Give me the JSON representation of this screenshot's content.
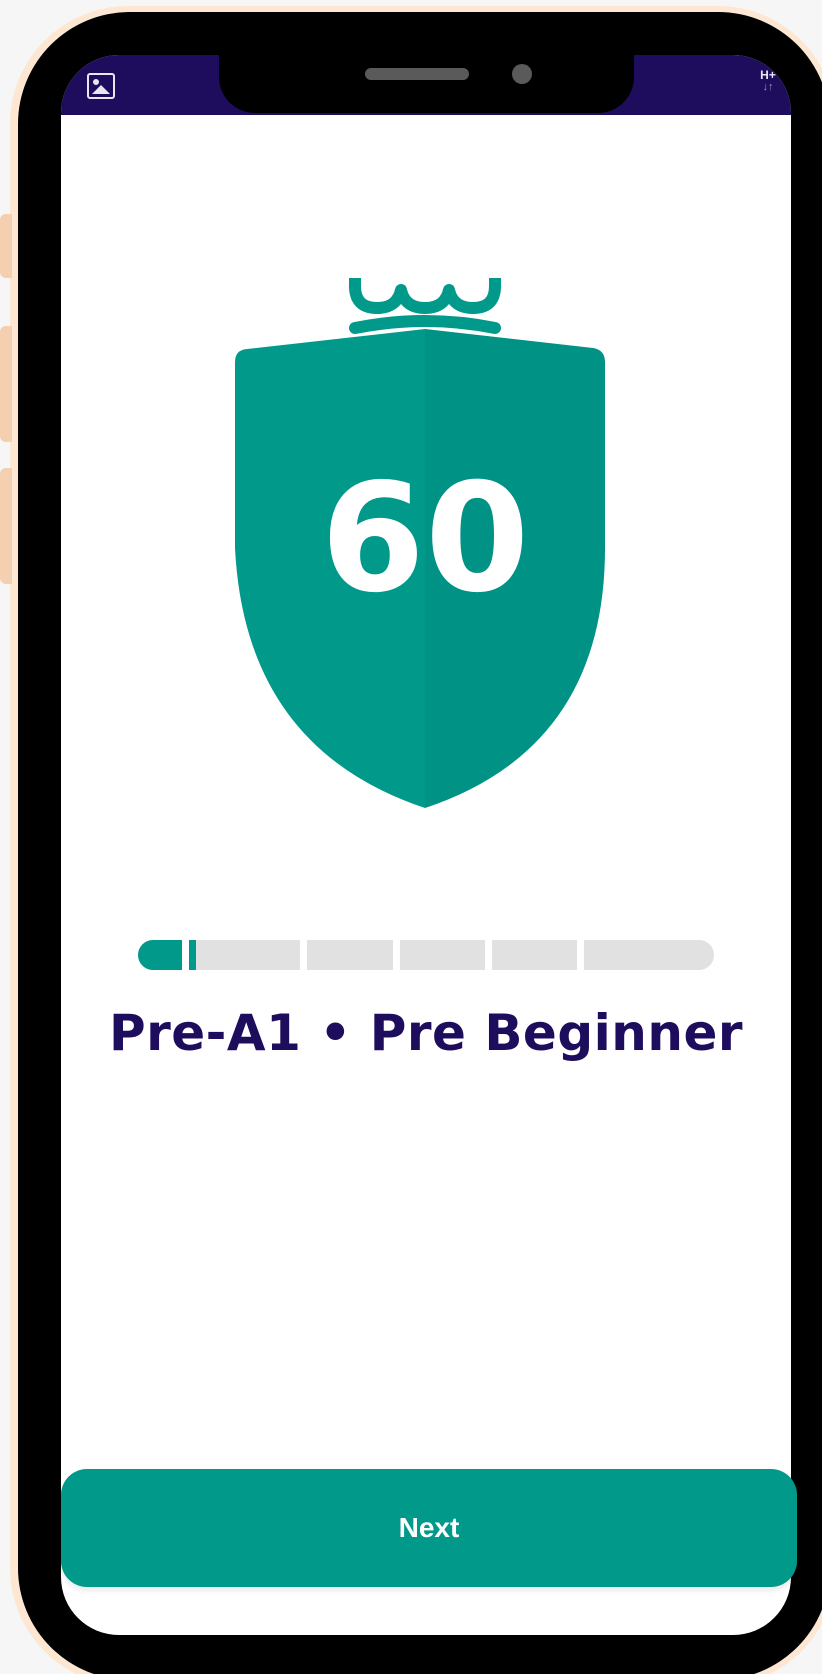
{
  "status_bar": {
    "left_icon": "image-icon",
    "network_label": "H+",
    "network_arrows": "↓↑"
  },
  "badge": {
    "score": "60",
    "icon": "crown-shield-icon",
    "color": "#00998a"
  },
  "progress": {
    "segments": 6,
    "completed_fraction": 0.1
  },
  "level": {
    "title": "Pre-A1 • Pre Beginner"
  },
  "footer": {
    "next_label": "Next"
  },
  "colors": {
    "brand_teal": "#00998a",
    "brand_navy": "#1e0c5c",
    "track_gray": "#e1e1e1"
  }
}
